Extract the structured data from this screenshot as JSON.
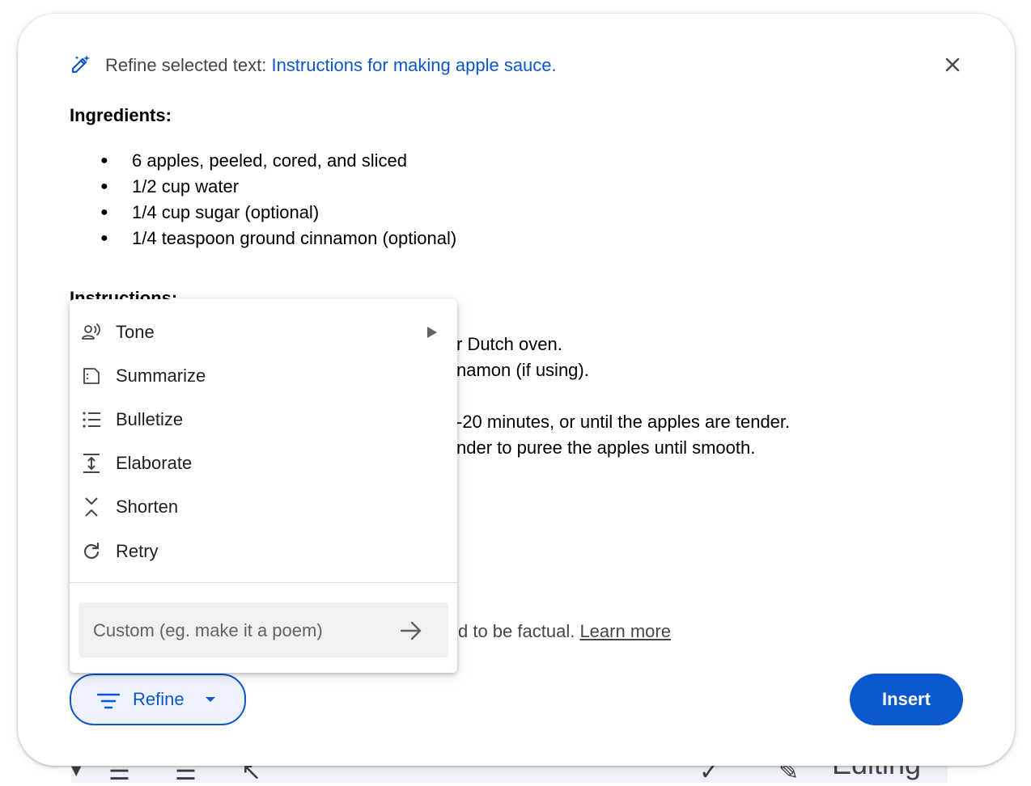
{
  "header": {
    "prefix": "Refine selected text: ",
    "selection": "Instructions for making apple sauce."
  },
  "content": {
    "ingredients_heading": "Ingredients:",
    "ingredients": [
      "6 apples, peeled, cored, and sliced",
      "1/2 cup water",
      "1/4 cup sugar (optional)",
      "1/4 teaspoon ground cinnamon (optional)"
    ],
    "instructions_heading": "Instructions:",
    "visible_step_fragments": [
      "r Dutch oven.",
      "namon (if using).",
      "-20 minutes, or until the apples are tender.",
      "nder to puree the apples until smooth."
    ]
  },
  "disclaimer": {
    "text": "d to be factual. ",
    "link": "Learn more"
  },
  "menu": {
    "items": [
      {
        "label": "Tone",
        "icon": "tone-icon",
        "has_submenu": true
      },
      {
        "label": "Summarize",
        "icon": "summarize-icon"
      },
      {
        "label": "Bulletize",
        "icon": "bulletize-icon"
      },
      {
        "label": "Elaborate",
        "icon": "elaborate-icon"
      },
      {
        "label": "Shorten",
        "icon": "shorten-icon"
      },
      {
        "label": "Retry",
        "icon": "retry-icon"
      }
    ],
    "custom_placeholder": "Custom (eg. make it a poem)",
    "custom_value": ""
  },
  "buttons": {
    "refine": "Refine",
    "insert": "Insert"
  },
  "background_toolbar": {
    "label": "Editing"
  },
  "colors": {
    "accent": "#0b57d0",
    "text": "#1f1f1f",
    "muted": "#444746"
  }
}
